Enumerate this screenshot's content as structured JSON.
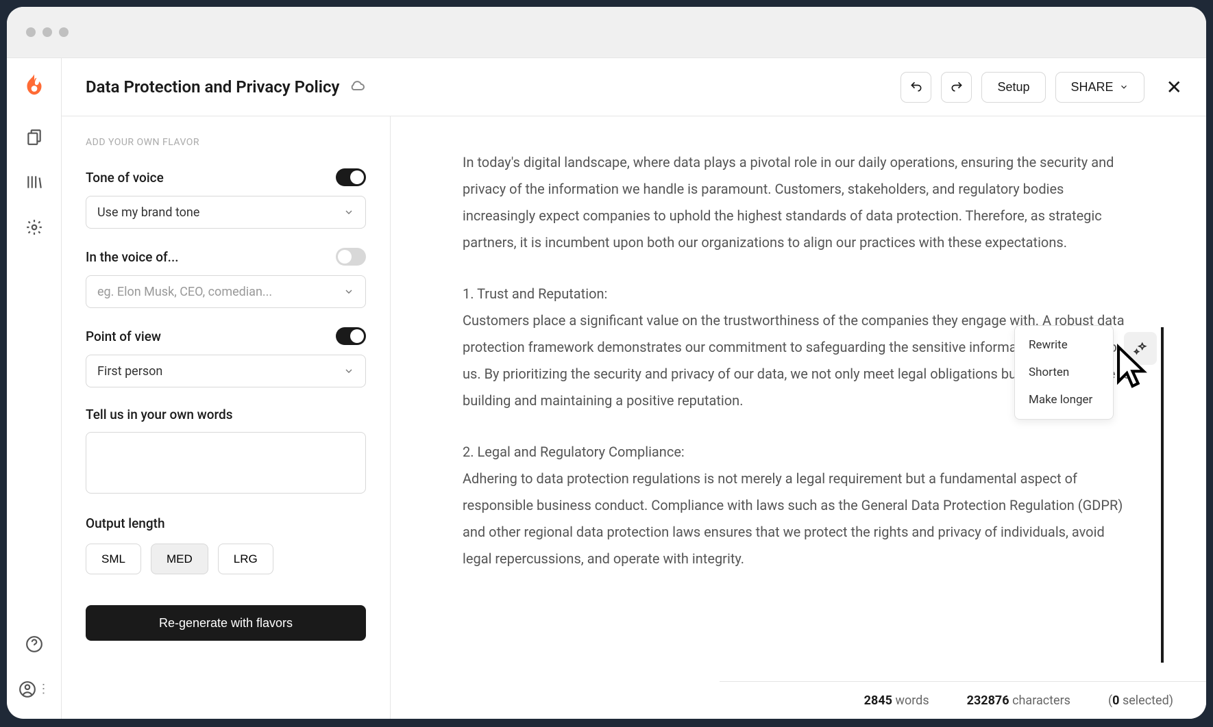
{
  "header": {
    "title": "Data Protection and Privacy Policy",
    "setup_label": "Setup",
    "share_label": "SHARE"
  },
  "panel": {
    "heading": "ADD YOUR OWN FLAVOR",
    "tone": {
      "label": "Tone of voice",
      "value": "Use my brand tone",
      "on": true
    },
    "voice": {
      "label": "In the voice of...",
      "placeholder": "eg. Elon Musk, CEO, comedian...",
      "on": false
    },
    "pov": {
      "label": "Point of view",
      "value": "First person",
      "on": true
    },
    "own_words": {
      "label": "Tell us in your own words"
    },
    "length": {
      "label": "Output length",
      "options": [
        "SML",
        "MED",
        "LRG"
      ],
      "selected": "MED"
    },
    "regenerate_label": "Re-generate with flavors"
  },
  "content": {
    "p1": "In today's digital landscape, where data plays a pivotal role in our daily operations, ensuring the security and privacy of the information we handle is paramount. Customers, stakeholders, and regulatory bodies increasingly expect companies to uphold the highest standards of data protection. Therefore, as strategic partners, it is incumbent upon both our organizations to align our practices with these expectations.",
    "h1": "1. Trust and Reputation:",
    "p2": "Customers place a significant value on the trustworthiness of the companies they engage with. A robust data protection framework demonstrates our commitment to safeguarding the sensitive information entrusted to us. By prioritizing the security and privacy of our data, we not only meet legal obligations but also contribute to building and maintaining a positive reputation.",
    "h2": "2. Legal and Regulatory Compliance:",
    "p3": "Adhering to data protection regulations is not merely a legal requirement but a fundamental aspect of responsible business conduct. Compliance with laws such as the General Data Protection Regulation (GDPR) and other regional data protection laws ensures that we protect the rights and privacy of individuals, avoid legal repercussions, and operate with integrity."
  },
  "ai_menu": {
    "items": [
      "Rewrite",
      "Shorten",
      "Make longer"
    ]
  },
  "status": {
    "words_count": "2845",
    "words_label": "words",
    "chars_count": "232876",
    "chars_label": "characters",
    "selected_count": "0",
    "selected_label": "selected"
  }
}
